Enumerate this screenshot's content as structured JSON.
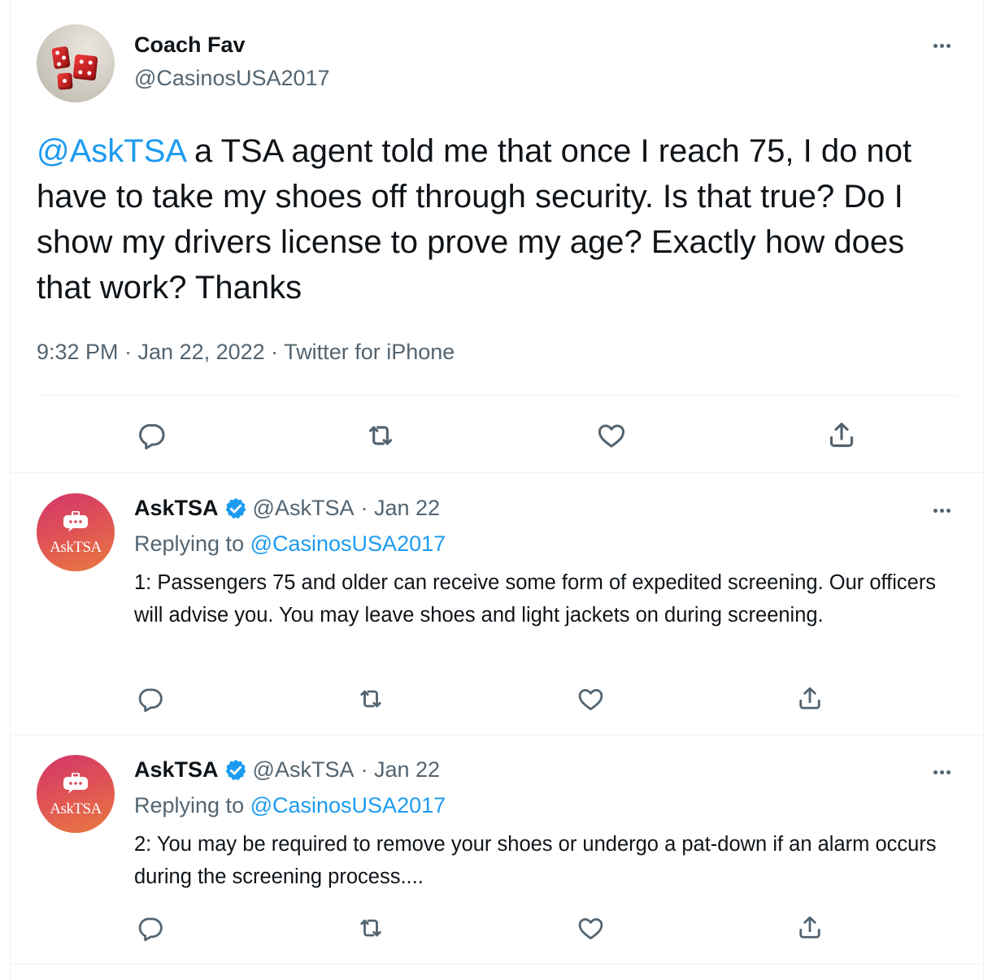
{
  "main_tweet": {
    "author_name": "Coach Fav",
    "author_handle": "@CasinosUSA2017",
    "mention": "@AskTSA",
    "text": " a TSA agent told me that once I reach 75, I do not have to take my shoes off through security. Is that true? Do I show my drivers license to prove my age? Exactly how does that work?  Thanks",
    "timestamp": "9:32 PM · Jan 22, 2022 · Twitter for iPhone"
  },
  "replies": [
    {
      "author_name": "AskTSA",
      "author_handle": "@AskTSA",
      "date": "· Jan 22",
      "avatar_text": "AskTSA",
      "replying_prefix": "Replying to ",
      "replying_to": "@CasinosUSA2017",
      "text": "1: Passengers 75 and older can receive some form of expedited screening. Our officers will advise you. You may leave shoes and light jackets on during screening."
    },
    {
      "author_name": "AskTSA",
      "author_handle": "@AskTSA",
      "date": "· Jan 22",
      "avatar_text": "AskTSA",
      "replying_prefix": "Replying to ",
      "replying_to": "@CasinosUSA2017",
      "text": "2: You may be required to remove your shoes or undergo a pat-down if an alarm occurs during the screening process...."
    }
  ],
  "actions": [
    "reply-icon",
    "retweet-icon",
    "like-icon",
    "share-icon"
  ],
  "colors": {
    "accent": "#1d9bf0",
    "text": "#0f1419",
    "secondary": "#536471",
    "border": "#eff3f4"
  }
}
